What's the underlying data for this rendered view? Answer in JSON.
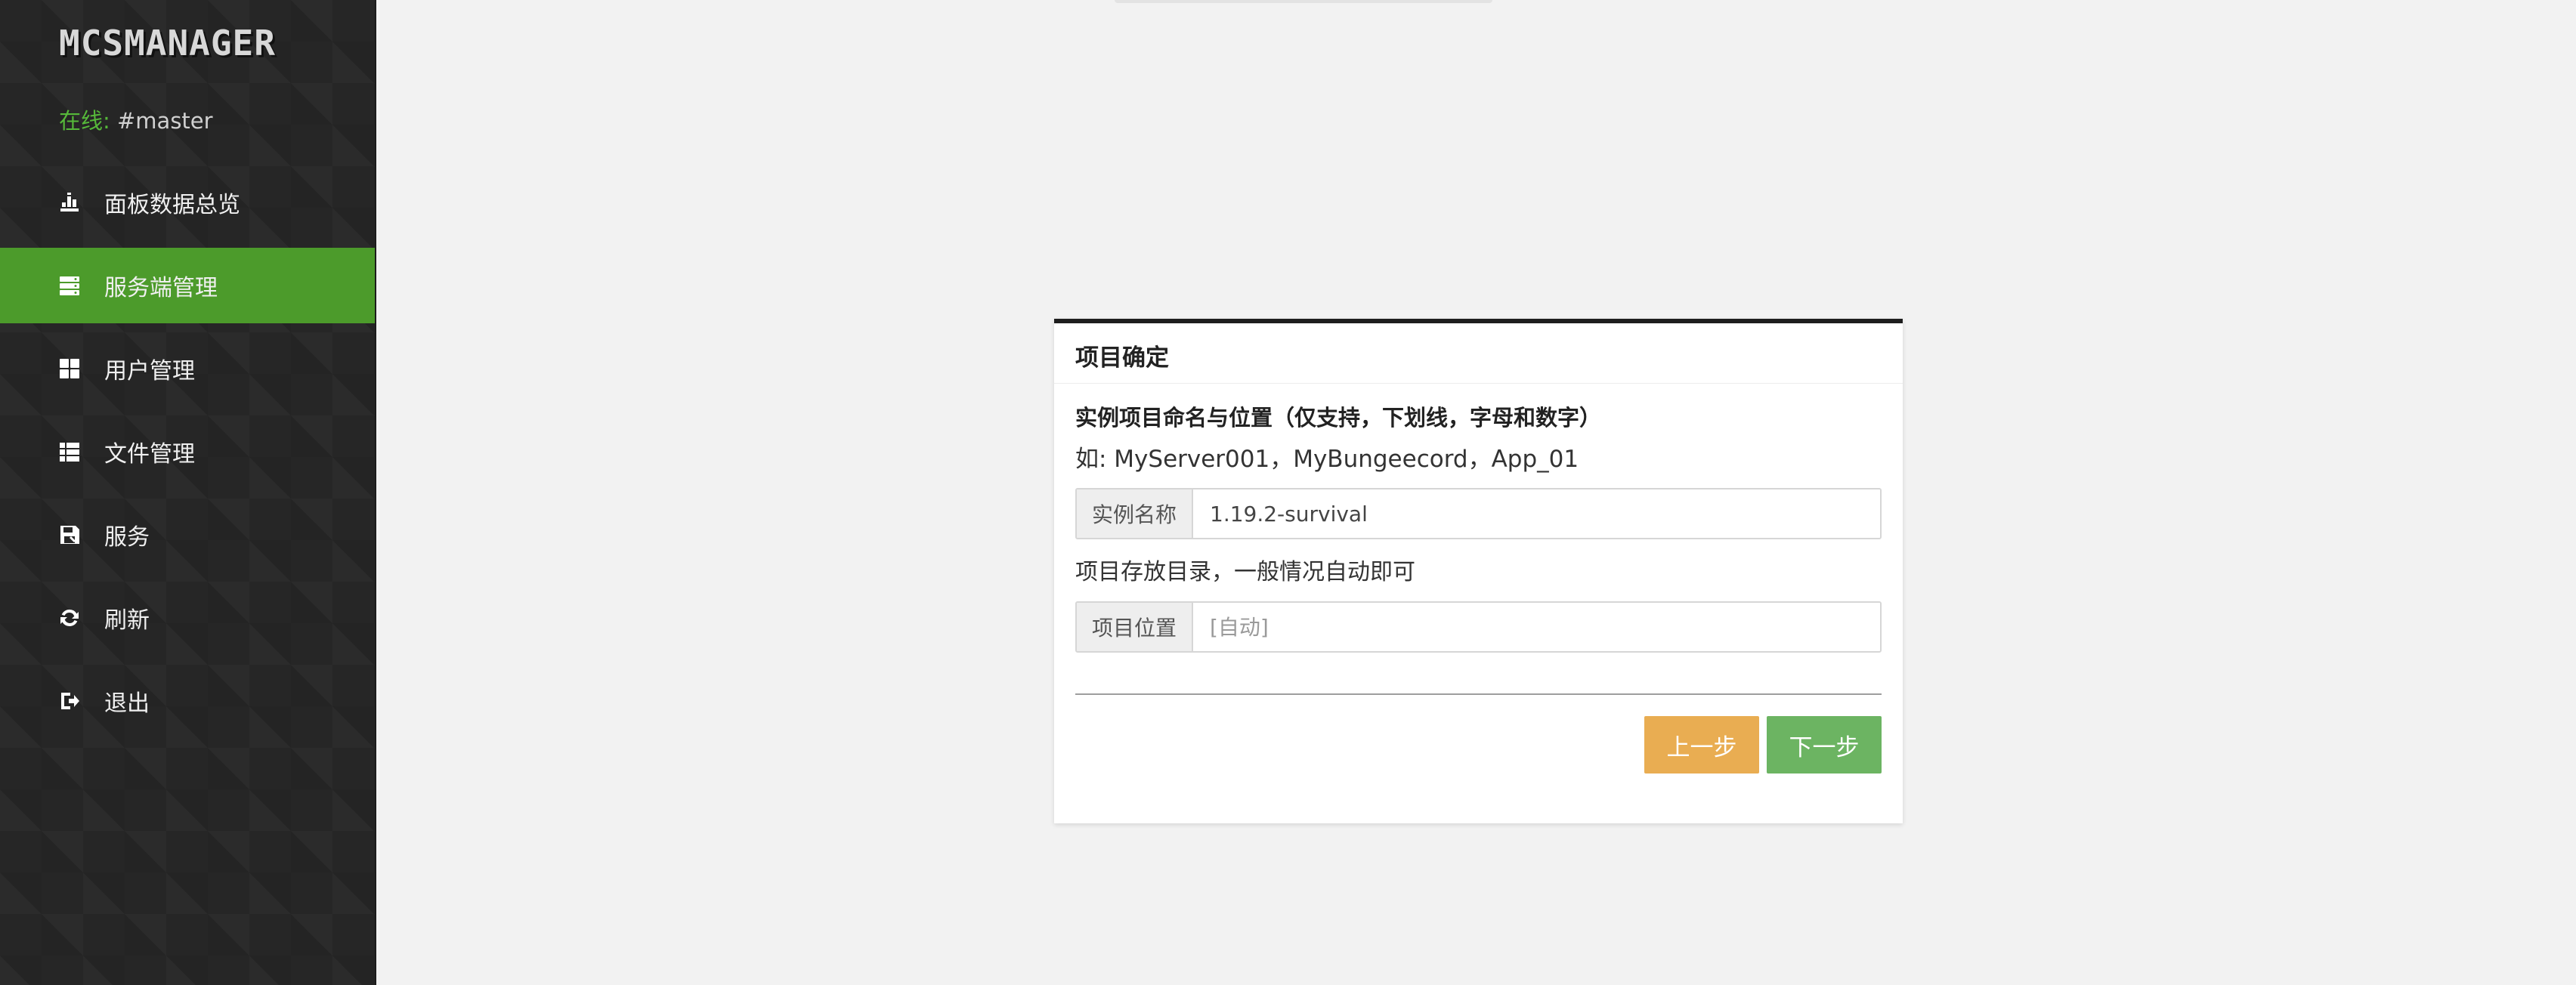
{
  "sidebar": {
    "logo": "MCSMANAGER",
    "online_label": "在线:",
    "online_name": "#master",
    "items": [
      {
        "label": "面板数据总览",
        "icon": "bar-chart-icon"
      },
      {
        "label": "服务端管理",
        "icon": "server-icon",
        "active": true
      },
      {
        "label": "用户管理",
        "icon": "grid-icon"
      },
      {
        "label": "文件管理",
        "icon": "list-icon"
      },
      {
        "label": "服务",
        "icon": "save-icon"
      },
      {
        "label": "刷新",
        "icon": "refresh-icon"
      },
      {
        "label": "退出",
        "icon": "sign-out-icon"
      }
    ]
  },
  "dialog": {
    "title": "项目确定",
    "section_title": "实例项目命名与位置（仅支持，下划线，字母和数字）",
    "example_hint": "如: MyServer001，MyBungeecord，App_01",
    "name_label": "实例名称",
    "name_value": "1.19.2-survival",
    "dir_hint": "项目存放目录，一般情况自动即可",
    "location_label": "项目位置",
    "location_placeholder": "[自动]",
    "prev_button": "上一步",
    "next_button": "下一步"
  },
  "colors": {
    "sidebar_bg": "#262626",
    "active_item": "#4c9b2b",
    "online_label": "#56b83a",
    "prev_button": "#e9ad52",
    "next_button": "#6cb462",
    "dialog_top_border": "#1e1e1e"
  }
}
